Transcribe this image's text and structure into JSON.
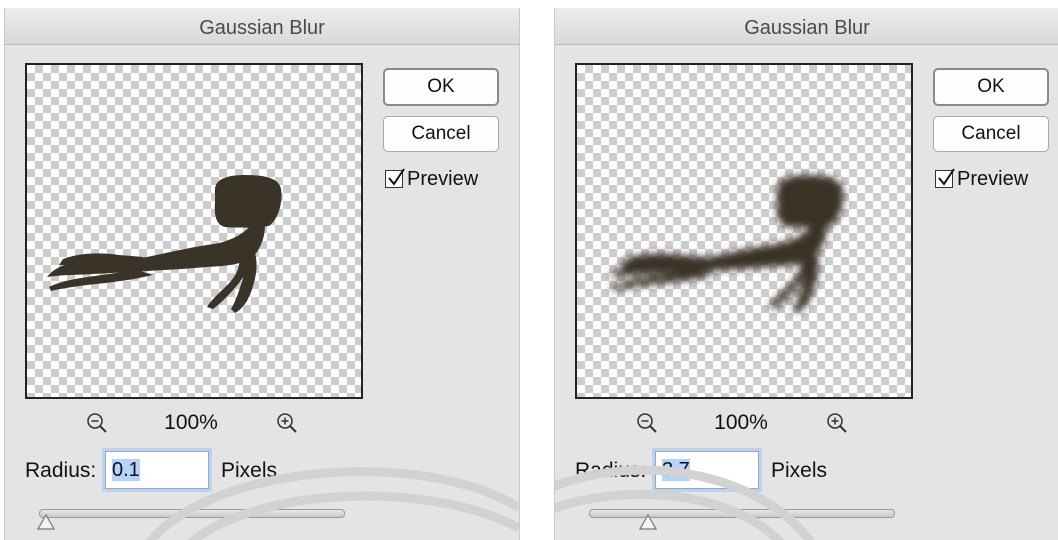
{
  "dialogs": [
    {
      "title": "Gaussian Blur",
      "ok_label": "OK",
      "cancel_label": "Cancel",
      "preview_label": "Preview",
      "preview_checked": true,
      "zoom_level": "100%",
      "radius_label": "Radius:",
      "radius_value": "0.1",
      "units_label": "Pixels",
      "slider_position": 0.0,
      "blur_radius_px": 0.1
    },
    {
      "title": "Gaussian Blur",
      "ok_label": "OK",
      "cancel_label": "Cancel",
      "preview_label": "Preview",
      "preview_checked": true,
      "zoom_level": "100%",
      "radius_label": "Radius:",
      "radius_value": "3.7",
      "units_label": "Pixels",
      "slider_position": 0.18,
      "blur_radius_px": 3.7
    }
  ],
  "icons": {
    "zoom_out": "zoom-out-magnifier-icon",
    "zoom_in": "zoom-in-magnifier-icon",
    "checkbox": "checkmark-icon",
    "slider_thumb": "triangle-slider-thumb-icon"
  },
  "colors": {
    "dialog_bg": "#e4e4e4",
    "silhouette": "#3a3328",
    "selection": "#b5d4fb",
    "focus_ring": "#b9d3f1"
  }
}
